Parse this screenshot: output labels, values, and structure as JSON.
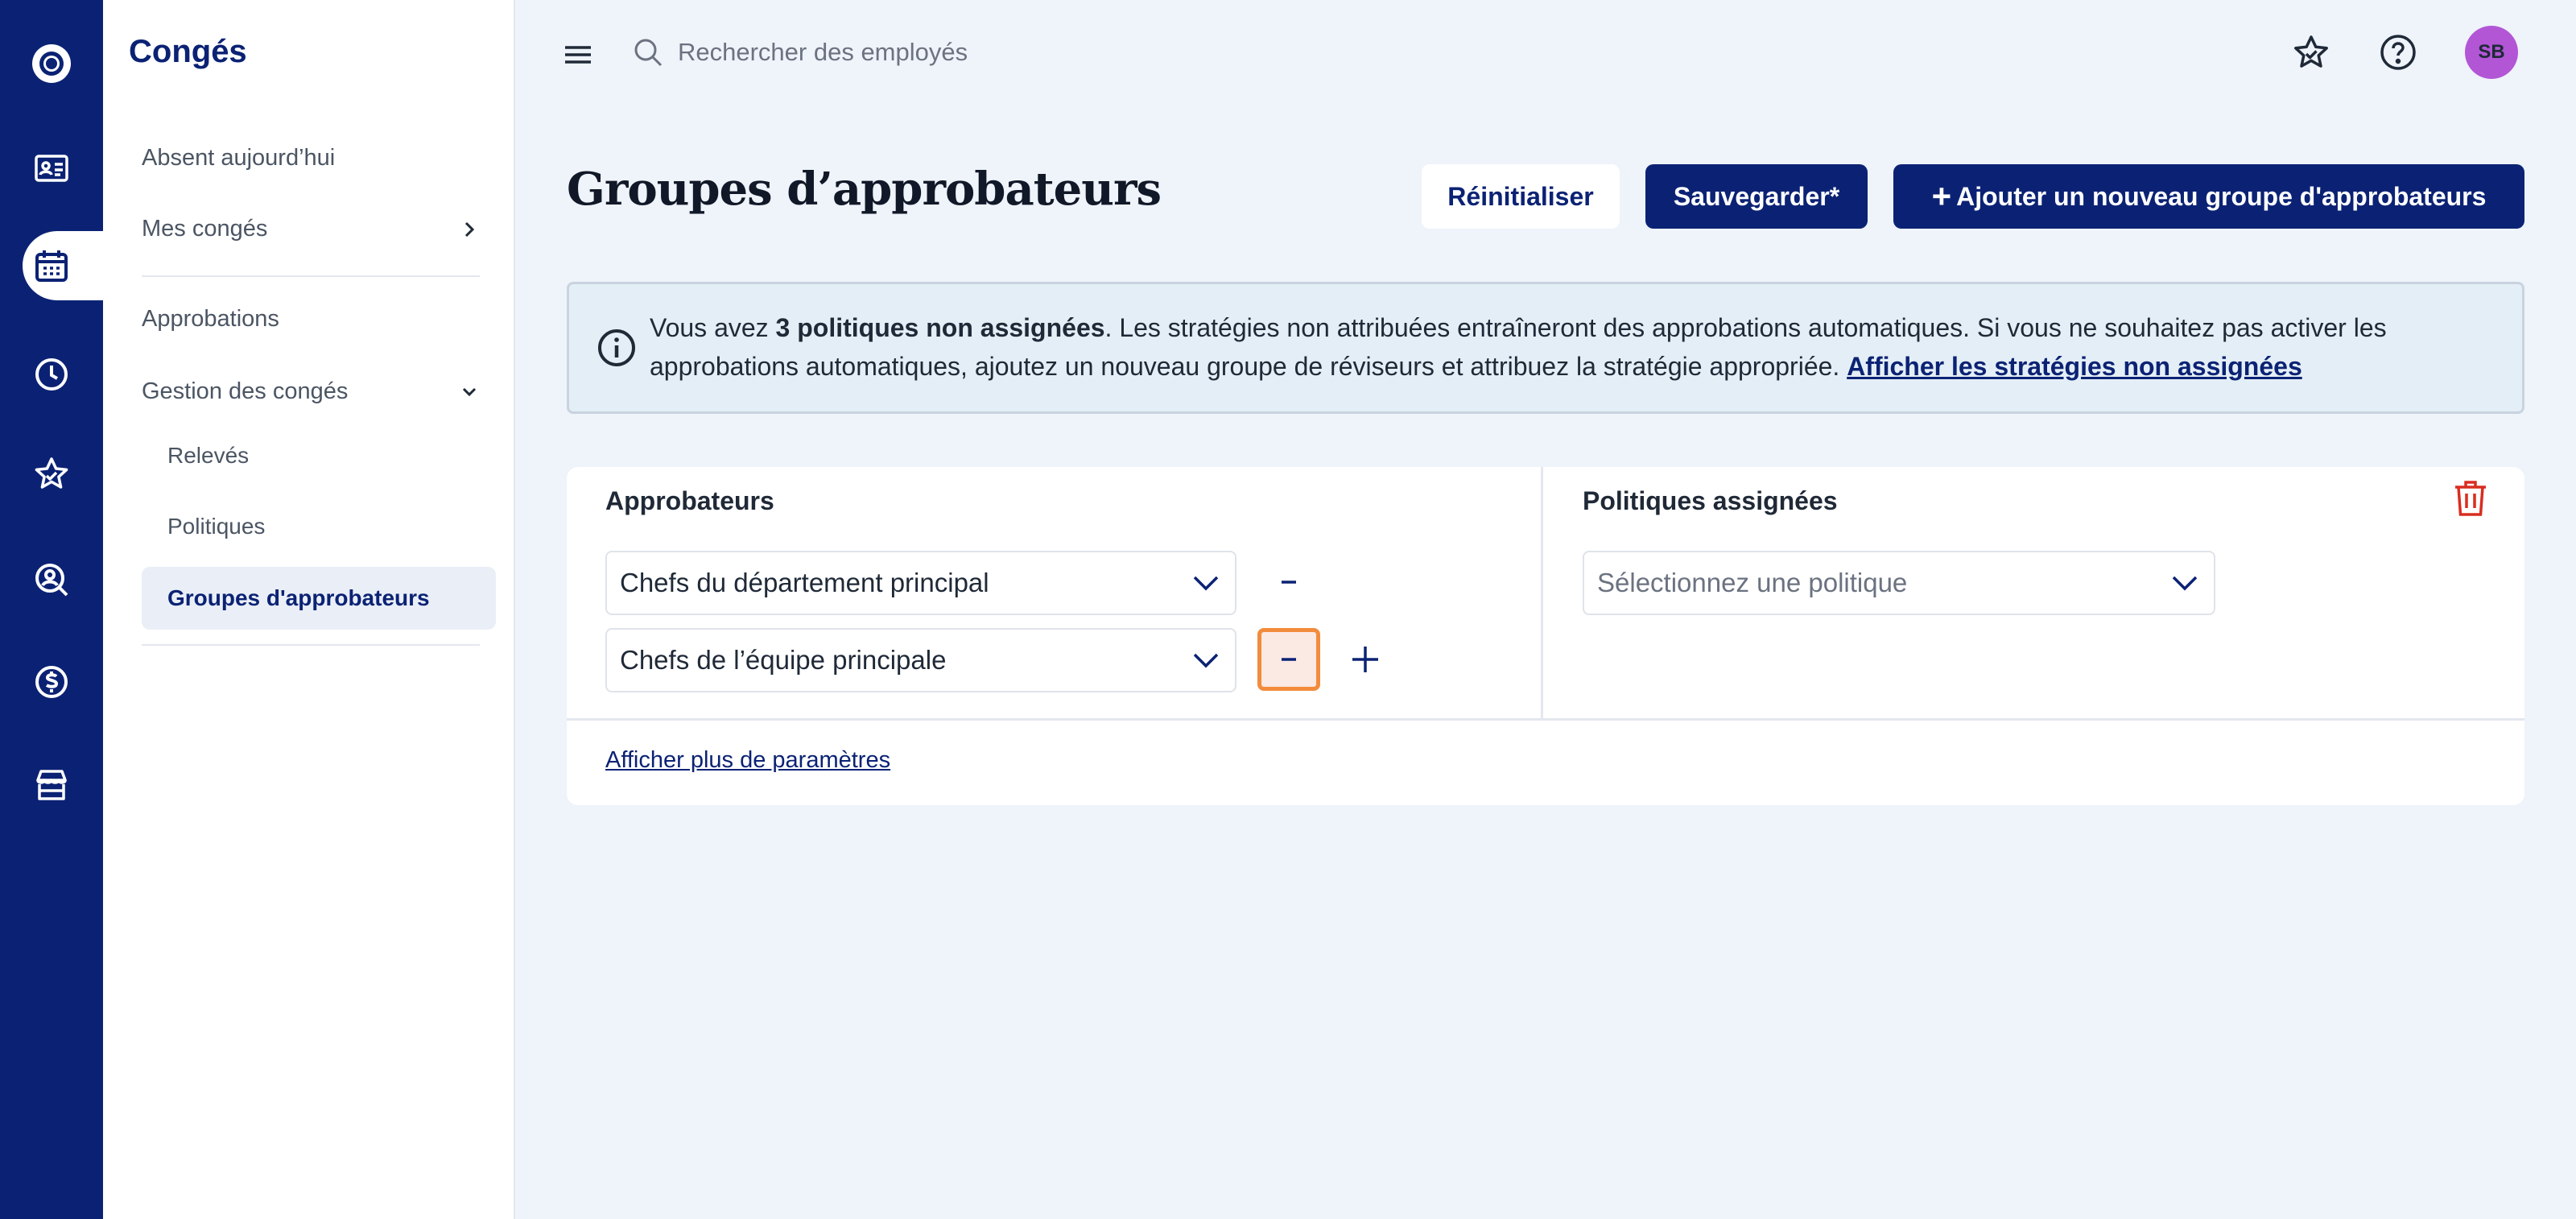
{
  "app": {
    "section_title": "Congés"
  },
  "sidebar": {
    "items": [
      {
        "label": "Absent aujourd’hui"
      },
      {
        "label": "Mes congés"
      },
      {
        "label": "Approbations"
      },
      {
        "label": "Gestion des congés"
      }
    ],
    "sub_items": [
      {
        "label": "Relevés"
      },
      {
        "label": "Politiques"
      },
      {
        "label": "Groupes d'approbateurs"
      }
    ]
  },
  "topbar": {
    "search_placeholder": "Rechercher des employés",
    "avatar_initials": "SB"
  },
  "header": {
    "title": "Groupes d’approbateurs",
    "reset_label": "Réinitialiser",
    "save_label": "Sauvegarder*",
    "add_plus": "+",
    "add_label": "Ajouter un nouveau groupe d'approbateurs"
  },
  "banner": {
    "text_before": "Vous avez ",
    "count_text": "3 politiques non assignées",
    "text_after": ". Les stratégies non attribuées entraîneront des approbations automatiques. Si vous ne souhaitez pas activer les approbations automatiques, ajoutez un nouveau groupe de réviseurs et attribuez la stratégie appropriée. ",
    "link_label": "Afficher les stratégies non assignées"
  },
  "group_card": {
    "approvers_heading": "Approbateurs",
    "policies_heading": "Politiques assignées",
    "approvers": [
      {
        "value": "Chefs du département principal"
      },
      {
        "value": "Chefs de l’équipe principale"
      }
    ],
    "policy_placeholder": "Sélectionnez une politique",
    "more_settings_label": "Afficher plus de paramètres"
  },
  "colors": {
    "navy": "#0b2274",
    "background": "#eff3fa",
    "avatar": "#b256d6",
    "delete_red": "#d92d20",
    "focus_orange": "#f28c3c"
  },
  "icons": [
    "logo-icon",
    "employee-card-icon",
    "calendar-icon",
    "clock-icon",
    "star-icon",
    "search-person-icon",
    "dollar-icon",
    "store-icon",
    "hamburger-menu-icon",
    "search-icon",
    "star-outline-icon",
    "help-icon",
    "chevron-right-icon",
    "chevron-down-icon",
    "info-icon",
    "trash-icon",
    "minus-icon",
    "plus-icon"
  ]
}
